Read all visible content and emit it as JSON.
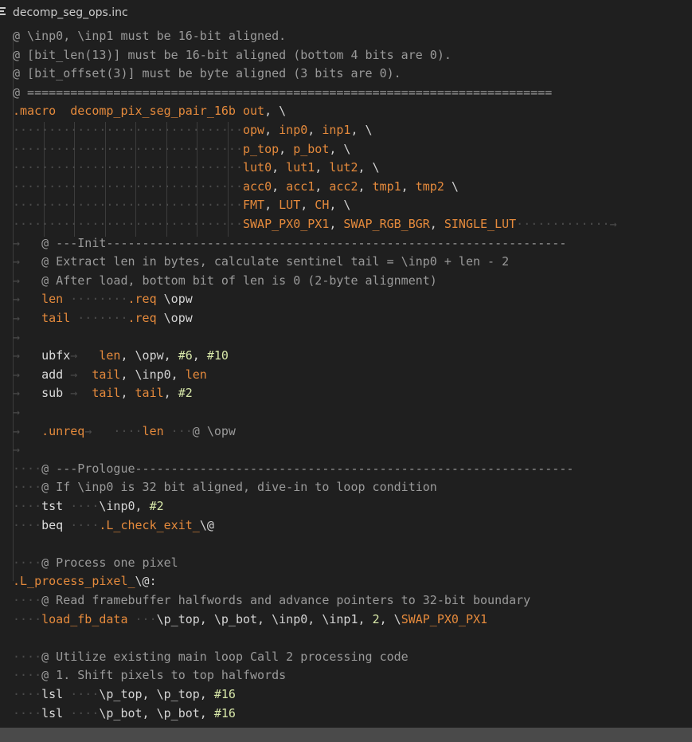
{
  "tab": {
    "title": "decomp_seg_ops.inc"
  },
  "lines": [
    {
      "segs": [
        [
          "c-comment",
          "@ \\inp0, \\inp1 must be 16-bit aligned."
        ]
      ]
    },
    {
      "segs": [
        [
          "c-comment",
          "@ [bit_len(13)] must be 16-bit aligned (bottom 4 bits are 0)."
        ]
      ]
    },
    {
      "segs": [
        [
          "c-comment",
          "@ [bit_offset(3)] must be byte aligned (3 bits are 0)."
        ]
      ]
    },
    {
      "segs": [
        [
          "c-comment",
          "@ ========================================================================="
        ]
      ]
    },
    {
      "segs": [
        [
          "c-macro",
          ".macro"
        ],
        [
          "c-text",
          "  "
        ],
        [
          "c-kw",
          "decomp_pix_seg_pair_16b"
        ],
        [
          "c-text",
          " "
        ],
        [
          "c-kw",
          "out"
        ],
        [
          "c-text",
          ", \\"
        ]
      ]
    },
    {
      "segs": [
        [
          "ws",
          "································"
        ],
        [
          "c-kw",
          "opw"
        ],
        [
          "c-text",
          ", "
        ],
        [
          "c-kw",
          "inp0"
        ],
        [
          "c-text",
          ", "
        ],
        [
          "c-kw",
          "inp1"
        ],
        [
          "c-text",
          ", \\"
        ]
      ]
    },
    {
      "segs": [
        [
          "ws",
          "································"
        ],
        [
          "c-kw",
          "p_top"
        ],
        [
          "c-text",
          ", "
        ],
        [
          "c-kw",
          "p_bot"
        ],
        [
          "c-text",
          ", \\"
        ]
      ]
    },
    {
      "segs": [
        [
          "ws",
          "································"
        ],
        [
          "c-kw",
          "lut0"
        ],
        [
          "c-text",
          ", "
        ],
        [
          "c-kw",
          "lut1"
        ],
        [
          "c-text",
          ", "
        ],
        [
          "c-kw",
          "lut2"
        ],
        [
          "c-text",
          ", \\"
        ]
      ]
    },
    {
      "segs": [
        [
          "ws",
          "································"
        ],
        [
          "c-kw",
          "acc0"
        ],
        [
          "c-text",
          ", "
        ],
        [
          "c-kw",
          "acc1"
        ],
        [
          "c-text",
          ", "
        ],
        [
          "c-kw",
          "acc2"
        ],
        [
          "c-text",
          ", "
        ],
        [
          "c-kw",
          "tmp1"
        ],
        [
          "c-text",
          ", "
        ],
        [
          "c-kw",
          "tmp2"
        ],
        [
          "c-text",
          " \\"
        ]
      ]
    },
    {
      "segs": [
        [
          "ws",
          "································"
        ],
        [
          "c-kw",
          "FMT"
        ],
        [
          "c-text",
          ", "
        ],
        [
          "c-kw",
          "LUT"
        ],
        [
          "c-text",
          ", "
        ],
        [
          "c-kw",
          "CH"
        ],
        [
          "c-text",
          ", \\"
        ]
      ]
    },
    {
      "segs": [
        [
          "ws",
          "································"
        ],
        [
          "c-kw",
          "SWAP_PX0_PX1"
        ],
        [
          "c-text",
          ", "
        ],
        [
          "c-kw",
          "SWAP_RGB_BGR"
        ],
        [
          "c-text",
          ", "
        ],
        [
          "c-kw",
          "SINGLE_LUT"
        ],
        [
          "ws",
          "·············→"
        ]
      ]
    },
    {
      "segs": [
        [
          "ws",
          "→   "
        ],
        [
          "c-comment",
          "@ ---Init----------------------------------------------------------------"
        ]
      ]
    },
    {
      "segs": [
        [
          "ws",
          "→   "
        ],
        [
          "c-comment",
          "@ Extract len in bytes, calculate sentinel tail = \\inp0 + len - 2"
        ]
      ]
    },
    {
      "segs": [
        [
          "ws",
          "→   "
        ],
        [
          "c-comment",
          "@ After load, bottom bit of len is 0 (2-byte alignment)"
        ]
      ]
    },
    {
      "segs": [
        [
          "ws",
          "→   "
        ],
        [
          "c-kw",
          "len"
        ],
        [
          "ws",
          " ········"
        ],
        [
          "c-macro",
          ".req"
        ],
        [
          "c-text",
          " \\opw"
        ]
      ]
    },
    {
      "segs": [
        [
          "ws",
          "→   "
        ],
        [
          "c-kw",
          "tail"
        ],
        [
          "ws",
          " ·······"
        ],
        [
          "c-macro",
          ".req"
        ],
        [
          "c-text",
          " \\opw"
        ]
      ]
    },
    {
      "segs": [
        [
          "ws",
          "→"
        ]
      ]
    },
    {
      "segs": [
        [
          "ws",
          "→   "
        ],
        [
          "c-white",
          "ubfx"
        ],
        [
          "ws",
          "→   "
        ],
        [
          "c-kw",
          "len"
        ],
        [
          "c-text",
          ", \\opw, "
        ],
        [
          "c-num",
          "#6"
        ],
        [
          "c-text",
          ", "
        ],
        [
          "c-num",
          "#10"
        ]
      ]
    },
    {
      "segs": [
        [
          "ws",
          "→   "
        ],
        [
          "c-white",
          "add"
        ],
        [
          "ws",
          " →  "
        ],
        [
          "c-kw",
          "tail"
        ],
        [
          "c-text",
          ", \\inp0, "
        ],
        [
          "c-kw",
          "len"
        ]
      ]
    },
    {
      "segs": [
        [
          "ws",
          "→   "
        ],
        [
          "c-white",
          "sub"
        ],
        [
          "ws",
          " →  "
        ],
        [
          "c-kw",
          "tail"
        ],
        [
          "c-text",
          ", "
        ],
        [
          "c-kw",
          "tail"
        ],
        [
          "c-text",
          ", "
        ],
        [
          "c-num",
          "#2"
        ]
      ]
    },
    {
      "segs": [
        [
          "ws",
          "→"
        ]
      ]
    },
    {
      "segs": [
        [
          "ws",
          "→   "
        ],
        [
          "c-macro",
          ".unreq"
        ],
        [
          "ws",
          "→   ····"
        ],
        [
          "c-kw",
          "len"
        ],
        [
          "ws",
          " ···"
        ],
        [
          "c-comment",
          "@ \\opw"
        ]
      ]
    },
    {
      "segs": [
        [
          "ws",
          "→"
        ]
      ]
    },
    {
      "segs": [
        [
          "ws",
          "····"
        ],
        [
          "c-comment",
          "@ ---Prologue-------------------------------------------------------------"
        ]
      ]
    },
    {
      "segs": [
        [
          "ws",
          "····"
        ],
        [
          "c-comment",
          "@ If \\inp0 is 32 bit aligned, dive-in to loop condition"
        ]
      ]
    },
    {
      "segs": [
        [
          "ws",
          "····"
        ],
        [
          "c-white",
          "tst"
        ],
        [
          "ws",
          " ····"
        ],
        [
          "c-text",
          "\\inp0, "
        ],
        [
          "c-num",
          "#2"
        ]
      ]
    },
    {
      "segs": [
        [
          "ws",
          "····"
        ],
        [
          "c-white",
          "beq"
        ],
        [
          "ws",
          " ····"
        ],
        [
          "c-kw",
          ".L_check_exit_"
        ],
        [
          "c-text",
          "\\@"
        ]
      ]
    },
    {
      "segs": [
        [
          "c-text",
          ""
        ]
      ]
    },
    {
      "segs": [
        [
          "ws",
          "····"
        ],
        [
          "c-comment",
          "@ Process one pixel"
        ]
      ]
    },
    {
      "segs": [
        [
          "c-kw",
          ".L_process_pixel_"
        ],
        [
          "c-text",
          "\\@:"
        ]
      ]
    },
    {
      "segs": [
        [
          "ws",
          "····"
        ],
        [
          "c-comment",
          "@ Read framebuffer halfwords and advance pointers to 32-bit boundary"
        ]
      ]
    },
    {
      "segs": [
        [
          "ws",
          "····"
        ],
        [
          "c-kw",
          "load_fb_data"
        ],
        [
          "ws",
          " ···"
        ],
        [
          "c-text",
          "\\p_top, \\p_bot, \\inp0, \\inp1, "
        ],
        [
          "c-num",
          "2"
        ],
        [
          "c-text",
          ", \\"
        ],
        [
          "c-kw",
          "SWAP_PX0_PX1"
        ]
      ]
    },
    {
      "segs": [
        [
          "c-text",
          ""
        ]
      ]
    },
    {
      "segs": [
        [
          "ws",
          "····"
        ],
        [
          "c-comment",
          "@ Utilize existing main loop Call 2 processing code"
        ]
      ]
    },
    {
      "segs": [
        [
          "ws",
          "····"
        ],
        [
          "c-comment",
          "@ 1. Shift pixels to top halfwords"
        ]
      ]
    },
    {
      "segs": [
        [
          "ws",
          "····"
        ],
        [
          "c-white",
          "lsl"
        ],
        [
          "ws",
          " ····"
        ],
        [
          "c-text",
          "\\p_top, \\p_top, "
        ],
        [
          "c-num",
          "#16"
        ]
      ]
    },
    {
      "segs": [
        [
          "ws",
          "····"
        ],
        [
          "c-white",
          "lsl"
        ],
        [
          "ws",
          " ····"
        ],
        [
          "c-text",
          "\\p_bot, \\p_bot, "
        ],
        [
          "c-num",
          "#16"
        ]
      ]
    }
  ]
}
